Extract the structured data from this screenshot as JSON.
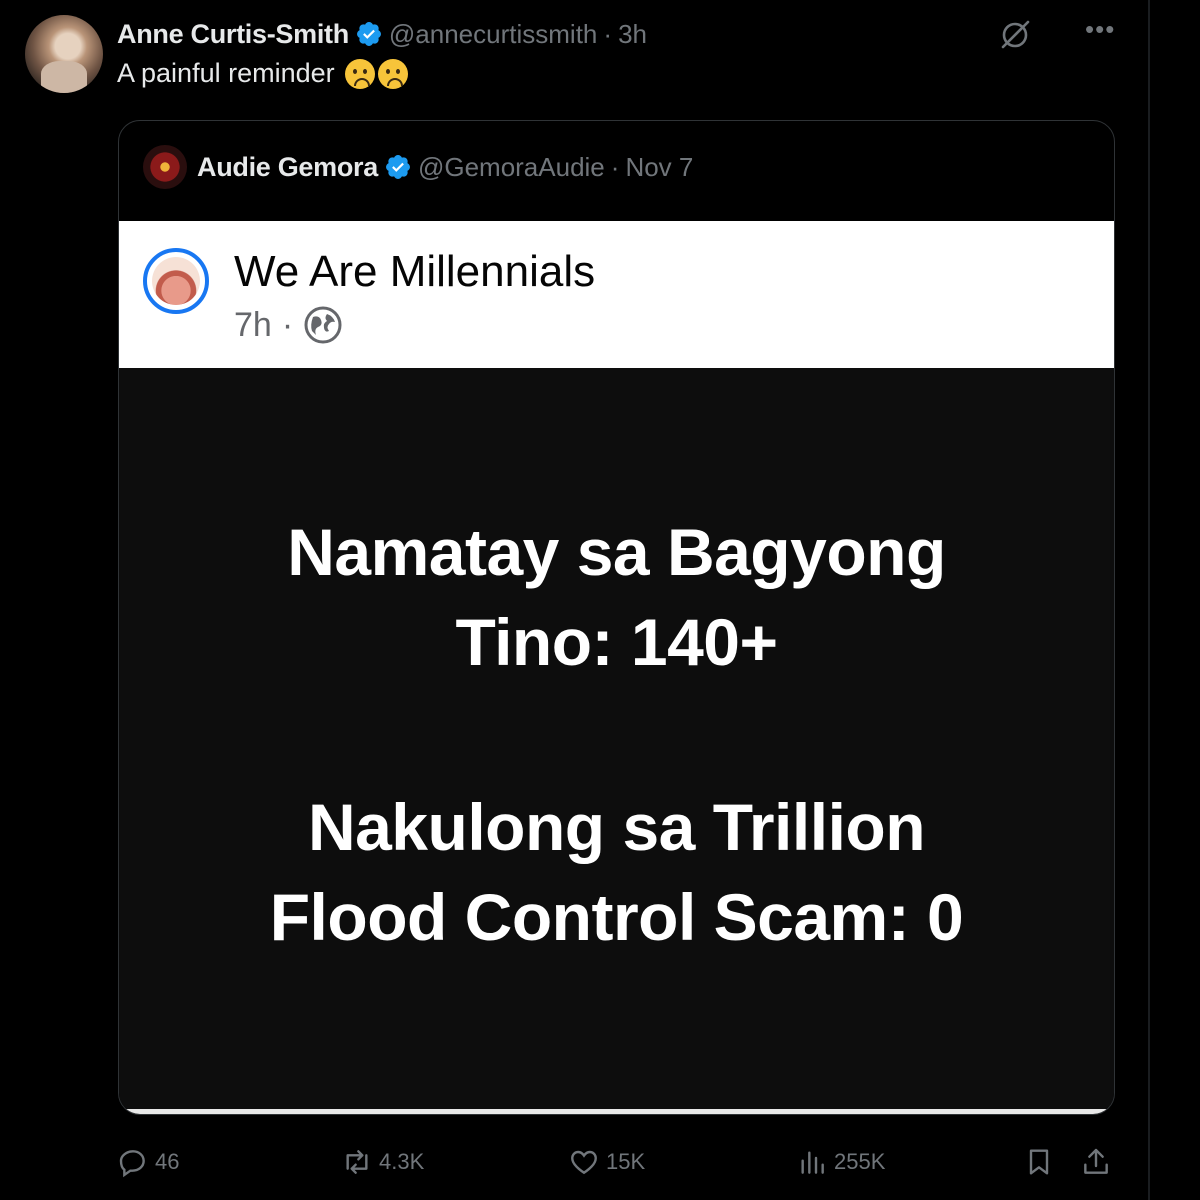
{
  "tweet": {
    "author_name": "Anne Curtis-Smith",
    "handle": "@annecurtissmith",
    "time": "3h",
    "separator": "·",
    "text": "A painful reminder",
    "emojis": [
      "frowning-face",
      "frowning-face"
    ]
  },
  "quote": {
    "author_name": "Audie Gemora",
    "handle": "@GemoraAudie",
    "separator": "·",
    "date": "Nov 7"
  },
  "facebook_post": {
    "page_name": "We Are Millennials",
    "time": "7h",
    "separator": "·",
    "line1a": "Namatay sa Bagyong",
    "line1b": "Tino: 140+",
    "line2a": "Nakulong sa Trillion",
    "line2b": "Flood Control Scam: 0"
  },
  "actions": {
    "replies": "46",
    "reposts": "4.3K",
    "likes": "15K",
    "views": "255K"
  },
  "icons": [
    "verified-badge-icon",
    "grok-icon",
    "more-icon",
    "globe-icon",
    "reply-icon",
    "repost-icon",
    "like-icon",
    "views-icon",
    "bookmark-icon",
    "share-icon"
  ],
  "colors": {
    "verified": "#1d9bf0",
    "muted": "#71767b",
    "text": "#e7e9ea",
    "background": "#000000"
  }
}
